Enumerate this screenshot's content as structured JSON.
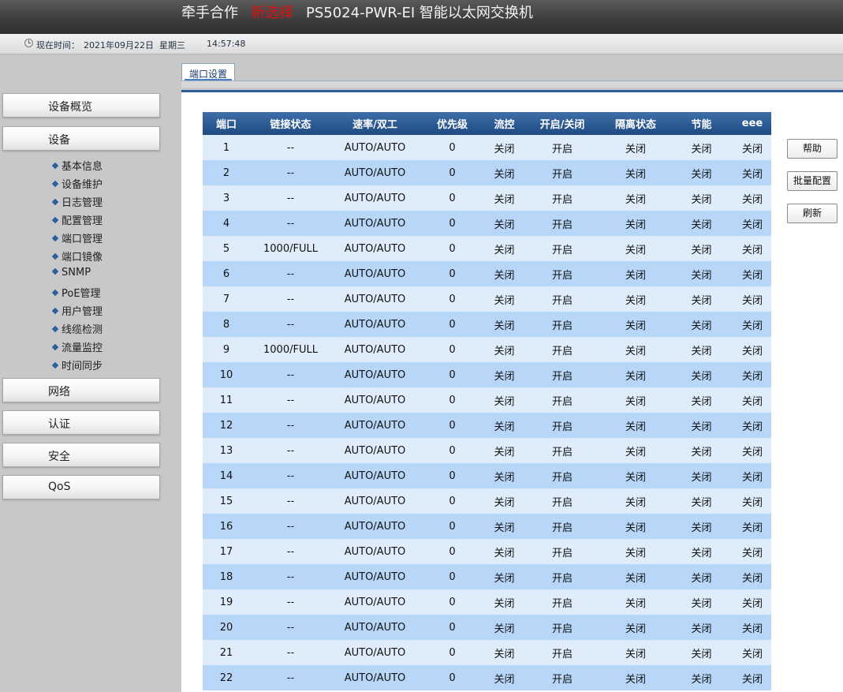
{
  "header": {
    "brand_part1": "牵手合作",
    "brand_part2": "新选择",
    "brand_part3": "PS5024-PWR-EI 智能以太网交换机"
  },
  "timebar": {
    "label": "现在时间：",
    "date": "2021年09月22日",
    "weekday": "星期三",
    "time": "14:57:48"
  },
  "sidebar": {
    "menus": [
      {
        "label": "设备概览"
      },
      {
        "label": "设备"
      },
      {
        "label": "网络"
      },
      {
        "label": "认证"
      },
      {
        "label": "安全"
      },
      {
        "label": "QoS"
      }
    ],
    "device_items": [
      {
        "label": "基本信息"
      },
      {
        "label": "设备维护"
      },
      {
        "label": "日志管理"
      },
      {
        "label": "配置管理"
      },
      {
        "label": "端口管理"
      },
      {
        "label": "端口镜像"
      },
      {
        "label": "SNMP"
      },
      {
        "label": "PoE管理"
      },
      {
        "label": "用户管理"
      },
      {
        "label": "线缆检测"
      },
      {
        "label": "流量监控"
      },
      {
        "label": "时间同步"
      }
    ]
  },
  "tab": {
    "label": "端口设置"
  },
  "table": {
    "headers": [
      "端口",
      "链接状态",
      "速率/双工",
      "优先级",
      "流控",
      "开启/关闭",
      "隔离状态",
      "节能",
      "eee"
    ],
    "rows": [
      [
        "1",
        "--",
        "AUTO/AUTO",
        "0",
        "关闭",
        "开启",
        "关闭",
        "关闭",
        "关闭"
      ],
      [
        "2",
        "--",
        "AUTO/AUTO",
        "0",
        "关闭",
        "开启",
        "关闭",
        "关闭",
        "关闭"
      ],
      [
        "3",
        "--",
        "AUTO/AUTO",
        "0",
        "关闭",
        "开启",
        "关闭",
        "关闭",
        "关闭"
      ],
      [
        "4",
        "--",
        "AUTO/AUTO",
        "0",
        "关闭",
        "开启",
        "关闭",
        "关闭",
        "关闭"
      ],
      [
        "5",
        "1000/FULL",
        "AUTO/AUTO",
        "0",
        "关闭",
        "开启",
        "关闭",
        "关闭",
        "关闭"
      ],
      [
        "6",
        "--",
        "AUTO/AUTO",
        "0",
        "关闭",
        "开启",
        "关闭",
        "关闭",
        "关闭"
      ],
      [
        "7",
        "--",
        "AUTO/AUTO",
        "0",
        "关闭",
        "开启",
        "关闭",
        "关闭",
        "关闭"
      ],
      [
        "8",
        "--",
        "AUTO/AUTO",
        "0",
        "关闭",
        "开启",
        "关闭",
        "关闭",
        "关闭"
      ],
      [
        "9",
        "1000/FULL",
        "AUTO/AUTO",
        "0",
        "关闭",
        "开启",
        "关闭",
        "关闭",
        "关闭"
      ],
      [
        "10",
        "--",
        "AUTO/AUTO",
        "0",
        "关闭",
        "开启",
        "关闭",
        "关闭",
        "关闭"
      ],
      [
        "11",
        "--",
        "AUTO/AUTO",
        "0",
        "关闭",
        "开启",
        "关闭",
        "关闭",
        "关闭"
      ],
      [
        "12",
        "--",
        "AUTO/AUTO",
        "0",
        "关闭",
        "开启",
        "关闭",
        "关闭",
        "关闭"
      ],
      [
        "13",
        "--",
        "AUTO/AUTO",
        "0",
        "关闭",
        "开启",
        "关闭",
        "关闭",
        "关闭"
      ],
      [
        "14",
        "--",
        "AUTO/AUTO",
        "0",
        "关闭",
        "开启",
        "关闭",
        "关闭",
        "关闭"
      ],
      [
        "15",
        "--",
        "AUTO/AUTO",
        "0",
        "关闭",
        "开启",
        "关闭",
        "关闭",
        "关闭"
      ],
      [
        "16",
        "--",
        "AUTO/AUTO",
        "0",
        "关闭",
        "开启",
        "关闭",
        "关闭",
        "关闭"
      ],
      [
        "17",
        "--",
        "AUTO/AUTO",
        "0",
        "关闭",
        "开启",
        "关闭",
        "关闭",
        "关闭"
      ],
      [
        "18",
        "--",
        "AUTO/AUTO",
        "0",
        "关闭",
        "开启",
        "关闭",
        "关闭",
        "关闭"
      ],
      [
        "19",
        "--",
        "AUTO/AUTO",
        "0",
        "关闭",
        "开启",
        "关闭",
        "关闭",
        "关闭"
      ],
      [
        "20",
        "--",
        "AUTO/AUTO",
        "0",
        "关闭",
        "开启",
        "关闭",
        "关闭",
        "关闭"
      ],
      [
        "21",
        "--",
        "AUTO/AUTO",
        "0",
        "关闭",
        "开启",
        "关闭",
        "关闭",
        "关闭"
      ],
      [
        "22",
        "--",
        "AUTO/AUTO",
        "0",
        "关闭",
        "开启",
        "关闭",
        "关闭",
        "关闭"
      ]
    ]
  },
  "buttons": {
    "help": "帮助",
    "batch": "批量配置",
    "refresh": "刷新"
  }
}
